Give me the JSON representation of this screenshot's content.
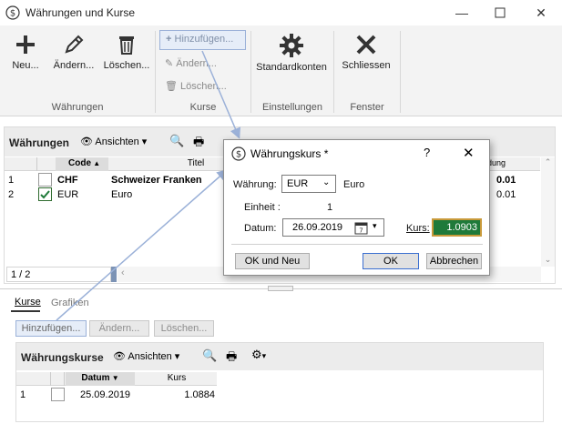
{
  "window": {
    "title": "Währungen und Kurse"
  },
  "ribbon": {
    "groups": {
      "waehrungen": "Währungen",
      "kurse": "Kurse",
      "einstellungen": "Einstellungen",
      "fenster": "Fenster"
    },
    "buttons": {
      "neu": "Neu...",
      "aendern": "Ändern...",
      "loeschen": "Löschen...",
      "kurse_hinzufuegen": "Hinzufügen...",
      "kurse_aendern": "Ändern...",
      "kurse_loeschen": "Löschen...",
      "standardkonten": "Standardkonten",
      "schliessen": "Schliessen"
    }
  },
  "upper": {
    "title": "Währungen",
    "ansichten": "Ansichten",
    "columns": {
      "code": "Code",
      "titel": "Titel",
      "dung": "dung"
    },
    "rows": [
      {
        "num": "1",
        "checked": false,
        "code": "CHF",
        "titel": "Schweizer Franken",
        "value": "0.01"
      },
      {
        "num": "2",
        "checked": true,
        "code": "EUR",
        "titel": "Euro",
        "value": "0.01"
      }
    ],
    "pager": "1 / 2"
  },
  "tabs": {
    "kurse": "Kurse",
    "grafiken": "Grafiken"
  },
  "lower": {
    "buttons": {
      "hinzufuegen": "Hinzufügen...",
      "aendern": "Ändern...",
      "loeschen": "Löschen..."
    },
    "title": "Währungskurse",
    "ansichten": "Ansichten",
    "columns": {
      "datum": "Datum",
      "kurs": "Kurs"
    },
    "rows": [
      {
        "num": "1",
        "datum": "25.09.2019",
        "kurs": "1.0884"
      }
    ]
  },
  "dialog": {
    "title": "Währungskurs *",
    "help": "?",
    "waehrung_label": "Währung:",
    "waehrung_value": "EUR",
    "waehrung_name": "Euro",
    "einheit_label": "Einheit :",
    "einheit_value": "1",
    "datum_label": "Datum:",
    "datum_value": "26.09.2019",
    "kurs_label": "Kurs:",
    "kurs_value": "1.0903",
    "btn_ok_neu": "OK und Neu",
    "btn_ok": "OK",
    "btn_abbrechen": "Abbrechen"
  },
  "colors": {
    "accent": "#1f7a3a",
    "focus": "#9bb1d8"
  }
}
